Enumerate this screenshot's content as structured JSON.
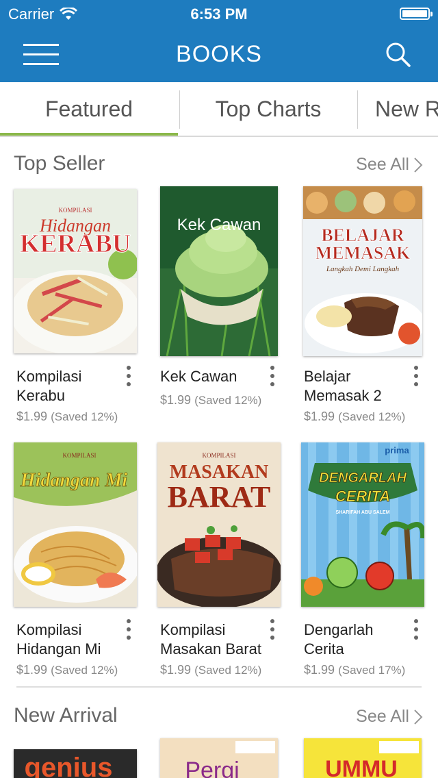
{
  "status_bar": {
    "carrier": "Carrier",
    "time": "6:53 PM"
  },
  "nav": {
    "title": "BOOKS"
  },
  "tabs": [
    {
      "label": "Featured",
      "active": true
    },
    {
      "label": "Top Charts",
      "active": false
    },
    {
      "label": "New R",
      "active": false
    }
  ],
  "sections": {
    "top_seller": {
      "title": "Top Seller",
      "see_all": "See All",
      "books": [
        {
          "title_line1": "Kompilasi",
          "title_line2": "Kerabu",
          "price": "$1.99",
          "saved": "(Saved 12%)",
          "cover_title": "KERABU",
          "cover_subtitle": "Hidangan",
          "cover_top": "KOMPILASI"
        },
        {
          "title_line1": "Kek Cawan",
          "title_line2": "",
          "price": "$1.99",
          "saved": "(Saved 12%)",
          "cover_title": "Kek Cawan"
        },
        {
          "title_line1": "Belajar",
          "title_line2": "Memasak 2",
          "price": "$1.99",
          "saved": "(Saved 12%)",
          "cover_title_1": "BELAJAR",
          "cover_title_2": "MEMASAK",
          "cover_subtitle": "Langkah Demi Langkah"
        },
        {
          "title_line1": "Kompilasi",
          "title_line2": "Hidangan Mi",
          "price": "$1.99",
          "saved": "(Saved 12%)",
          "cover_title": "Hidangan Mi",
          "cover_top": "KOMPILASI"
        },
        {
          "title_line1": "Kompilasi",
          "title_line2": "Masakan Barat",
          "price": "$1.99",
          "saved": "(Saved 12%)",
          "cover_title_1": "MASAKAN",
          "cover_title_2": "BARAT",
          "cover_top": "KOMPILASI"
        },
        {
          "title_line1": "Dengarlah",
          "title_line2": "Cerita",
          "price": "$1.99",
          "saved": "(Saved 17%)",
          "cover_title_1": "DENGARLAH",
          "cover_title_2": "CERITA",
          "cover_author": "SHARIFAH ABU SALEM",
          "cover_brand": "prima"
        }
      ]
    },
    "new_arrival": {
      "title": "New Arrival",
      "see_all": "See All",
      "covers": [
        "genius",
        "Pergi",
        "UMMU"
      ]
    }
  },
  "colors": {
    "header": "#1e7cbf",
    "tab_active": "#8bb84a"
  }
}
